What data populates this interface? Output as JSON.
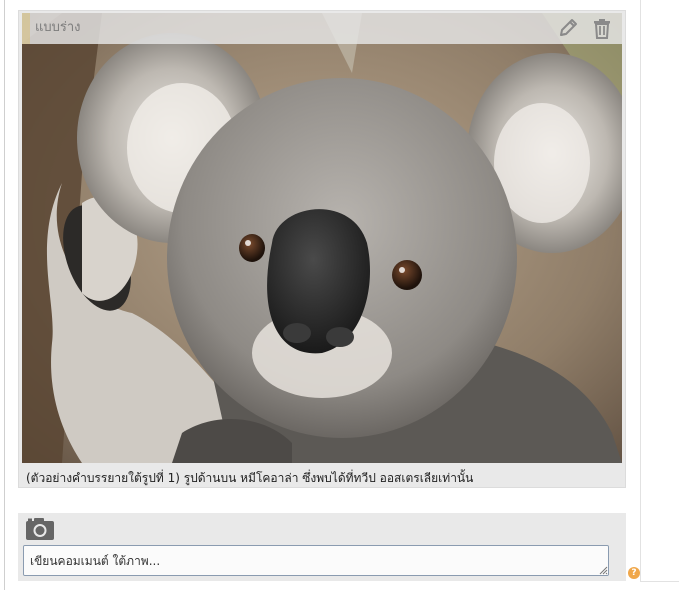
{
  "card": {
    "status_label": "แบบร่าง",
    "image_subject": "koala photo",
    "edit_icon": "pencil-icon",
    "delete_icon": "trash-icon",
    "caption": "(ตัวอย่างคำบรรยายใต้รูปที่ 1) รูปด้านบน หมีโคอาล่า ซึ่งพบได้ที่ทวีป ออสเตรเลียเท่านั้น"
  },
  "comment": {
    "camera_icon": "camera-icon",
    "placeholder": "เขียนคอมเมนต์ ใต้ภาพ...",
    "value": ""
  },
  "help": {
    "icon": "question-icon",
    "label": "?"
  },
  "colors": {
    "card_background": "#e9e9e9",
    "icon_gray": "#8a8a8a",
    "input_border": "#8a9bb0",
    "help_orange": "#f0a74a"
  }
}
